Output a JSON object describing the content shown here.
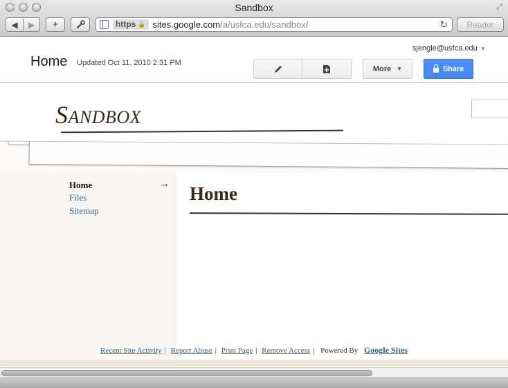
{
  "window": {
    "title": "Sandbox",
    "url_scheme": "https",
    "url_host": "sites.google.com",
    "url_path": "/a/usfca.edu/sandbox/",
    "reader_label": "Reader"
  },
  "header": {
    "page_title": "Home",
    "updated": "Updated Oct 11, 2010 2:31 PM",
    "account": "sjengle@usfca.edu",
    "more_label": "More",
    "share_label": "Share"
  },
  "site": {
    "name_initial": "S",
    "name_rest": "ANDBOX"
  },
  "sidebar": {
    "items": [
      {
        "label": "Home"
      },
      {
        "label": "Files"
      },
      {
        "label": "Sitemap"
      }
    ]
  },
  "main": {
    "title": "Home"
  },
  "footer": {
    "links": [
      {
        "label": "Recent Site Activity"
      },
      {
        "label": "Report Abuse"
      },
      {
        "label": "Print Page"
      },
      {
        "label": "Remove Access"
      }
    ],
    "powered_by": "Powered By",
    "google_sites": "Google Sites"
  },
  "icons": {
    "back": "back-arrow-icon",
    "forward": "forward-arrow-icon",
    "add": "plus-icon",
    "tools": "wrench-icon",
    "reload": "reload-icon",
    "edit": "pencil-icon",
    "new_page": "new-page-icon",
    "share_lock": "lock-icon",
    "nav_current": "right-arrow-icon"
  },
  "colors": {
    "share_button": "#4d90fe",
    "link": "#2a6496",
    "title_brown": "#3a2a12"
  }
}
